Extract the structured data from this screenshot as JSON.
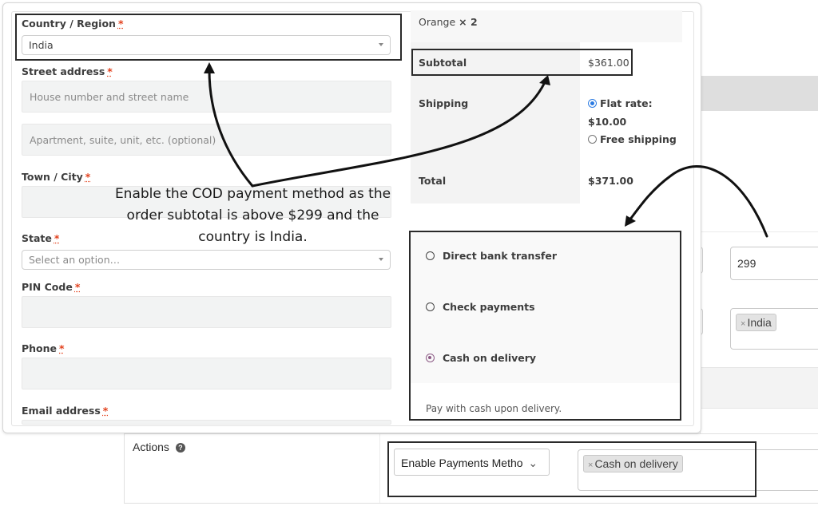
{
  "billing_form": {
    "country": {
      "label": "Country / Region",
      "required_mark": "*",
      "value": "India"
    },
    "street": {
      "label": "Street address",
      "required_mark": "*",
      "placeholder_1": "House number and street name",
      "placeholder_2": "Apartment, suite, unit, etc. (optional)"
    },
    "city": {
      "label": "Town / City",
      "required_mark": "*"
    },
    "state": {
      "label": "State",
      "required_mark": "*",
      "placeholder": "Select an option…"
    },
    "pin": {
      "label": "PIN Code",
      "required_mark": "*"
    },
    "phone": {
      "label": "Phone",
      "required_mark": "*"
    },
    "email": {
      "label": "Email address",
      "required_mark": "*"
    }
  },
  "order_review": {
    "item_name": "Orange",
    "item_qty": "× 2",
    "subtotal_label": "Subtotal",
    "subtotal_value": "$361.00",
    "shipping_label": "Shipping",
    "shipping_options": [
      {
        "label": "Flat rate:",
        "price": "$10.00",
        "selected": true
      },
      {
        "label": "Free shipping",
        "selected": false
      }
    ],
    "total_label": "Total",
    "total_value": "$371.00"
  },
  "payment_methods": {
    "options": [
      {
        "label": "Direct bank transfer",
        "selected": false
      },
      {
        "label": "Check payments",
        "selected": false
      },
      {
        "label": "Cash on delivery",
        "selected": true
      }
    ],
    "description": "Pay with cash upon delivery."
  },
  "rule_settings": {
    "subtotal_threshold": "299",
    "country_chip": "India",
    "chip_remove": "×",
    "actions_label": "Actions",
    "help_glyph": "?",
    "action_select": "Enable Payments Metho",
    "action_select_caret": "⌄",
    "action_chip": "Cash on delivery"
  },
  "annotation": {
    "text": "Enable the COD payment method as the order subtotal is above $299 and the country is India."
  },
  "colors": {
    "required": "#e2401c",
    "cod_radio": "#8c5a85",
    "shipping_radio": "#2a7ae2"
  }
}
